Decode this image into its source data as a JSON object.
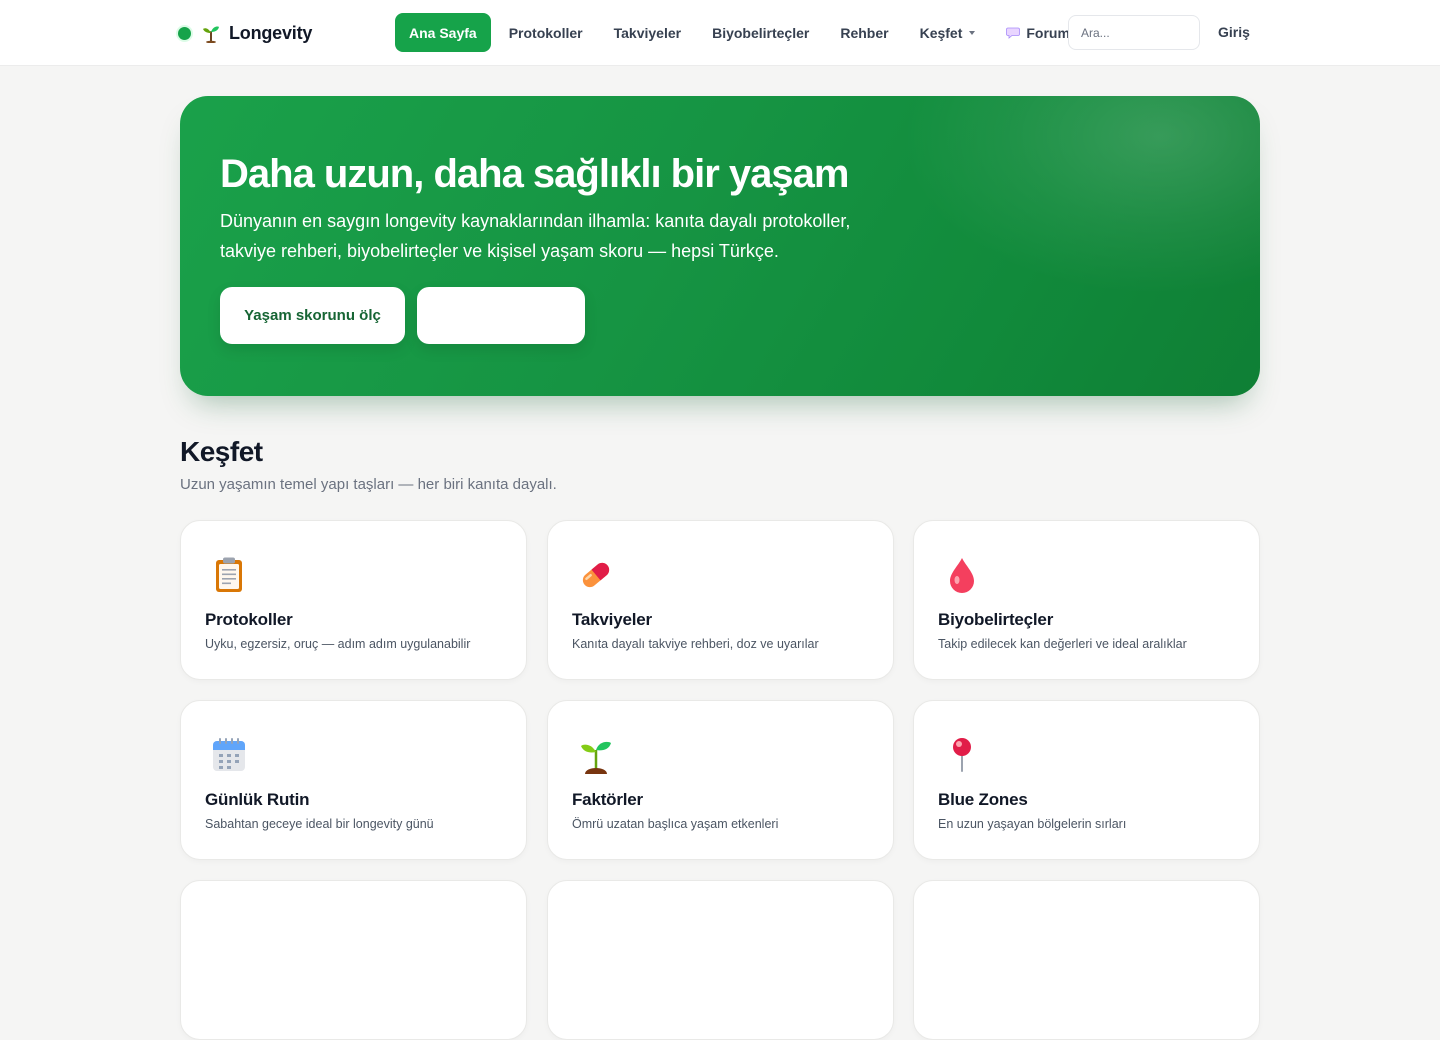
{
  "header": {
    "brand": "Longevity",
    "nav": [
      {
        "label": "Ana Sayfa",
        "active": true
      },
      {
        "label": "Protokoller"
      },
      {
        "label": "Takviyeler"
      },
      {
        "label": "Biyobelirteçler"
      },
      {
        "label": "Rehber"
      },
      {
        "label": "Keşfet",
        "dropdown": true
      },
      {
        "label": "Forum",
        "icon": "speech-bubble-icon"
      }
    ],
    "search_placeholder": "Ara...",
    "login": "Giriş"
  },
  "hero": {
    "title": "Daha uzun, daha sağlıklı bir yaşam",
    "subtitle": "Dünyanın en saygın longevity kaynaklarından ilhamla: kanıta dayalı protokoller, takviye rehberi, biyobelirteçler ve kişisel yaşam skoru — hepsi Türkçe.",
    "primary_button": "Yaşam skorunu ölç",
    "secondary_button": ""
  },
  "section": {
    "title": "Keşfet",
    "subtitle": "Uzun yaşamın temel yapı taşları — her biri kanıta dayalı."
  },
  "cards": [
    {
      "icon": "clipboard-icon",
      "title": "Protokoller",
      "desc": "Uyku, egzersiz, oruç — adım adım uygulanabilir"
    },
    {
      "icon": "pill-icon",
      "title": "Takviyeler",
      "desc": "Kanıta dayalı takviye rehberi, doz ve uyarılar"
    },
    {
      "icon": "drop-icon",
      "title": "Biyobelirteçler",
      "desc": "Takip edilecek kan değerleri ve ideal aralıklar"
    },
    {
      "icon": "calendar-icon",
      "title": "Günlük Rutin",
      "desc": "Sabahtan geceye ideal bir longevity günü"
    },
    {
      "icon": "seedling-icon",
      "title": "Faktörler",
      "desc": "Ömrü uzatan başlıca yaşam etkenleri"
    },
    {
      "icon": "pushpin-icon",
      "title": "Blue Zones",
      "desc": "En uzun yaşayan bölgelerin sırları"
    }
  ],
  "colors": {
    "accent": "#16a34a",
    "hero_gradient_start": "#1aa14a",
    "hero_gradient_end": "#0f7f35",
    "page_background": "#f5f5f4"
  }
}
